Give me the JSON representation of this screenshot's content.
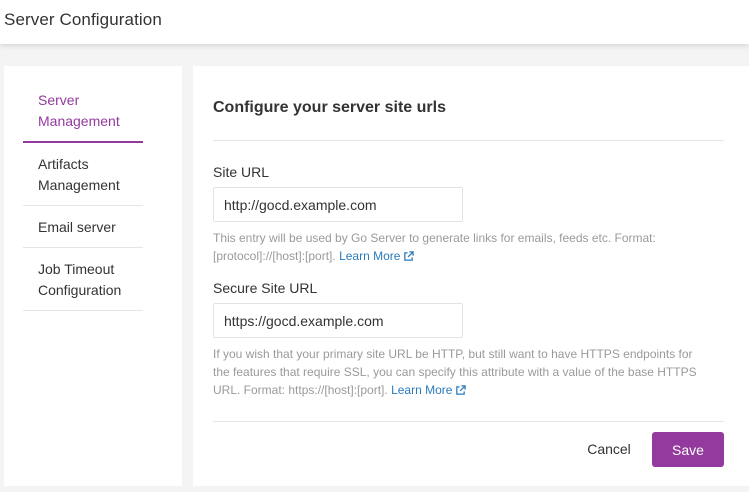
{
  "header": {
    "title": "Server Configuration"
  },
  "sidebar": {
    "items": [
      {
        "lines": [
          "Server",
          "Management"
        ],
        "active": true
      },
      {
        "lines": [
          "Artifacts",
          "Management"
        ],
        "active": false
      },
      {
        "lines": [
          "Email server"
        ],
        "active": false
      },
      {
        "lines": [
          "Job Timeout",
          "Configuration"
        ],
        "active": false
      }
    ]
  },
  "main": {
    "title": "Configure your server site urls",
    "site_url": {
      "label": "Site URL",
      "value": "http://gocd.example.com",
      "help_lines": [
        "This entry will be used by Go Server to generate links for emails, feeds etc. Format:",
        "[protocol]://[host]:[port]."
      ],
      "learn_more": "Learn More"
    },
    "secure_site_url": {
      "label": "Secure Site URL",
      "value": "https://gocd.example.com",
      "help_lines": [
        "If you wish that your primary site URL be HTTP, but still want to have HTTPS endpoints for",
        "the features that require SSL, you can specify this attribute with a value of the base HTTPS",
        "URL. Format: https://[host]:[port]."
      ],
      "learn_more": "Learn More"
    },
    "actions": {
      "cancel": "Cancel",
      "save": "Save"
    }
  },
  "colors": {
    "accent": "#943a9e",
    "link": "#2a7bbd",
    "help_text": "#9a9a9a"
  },
  "icons": [
    "external-link-icon"
  ]
}
